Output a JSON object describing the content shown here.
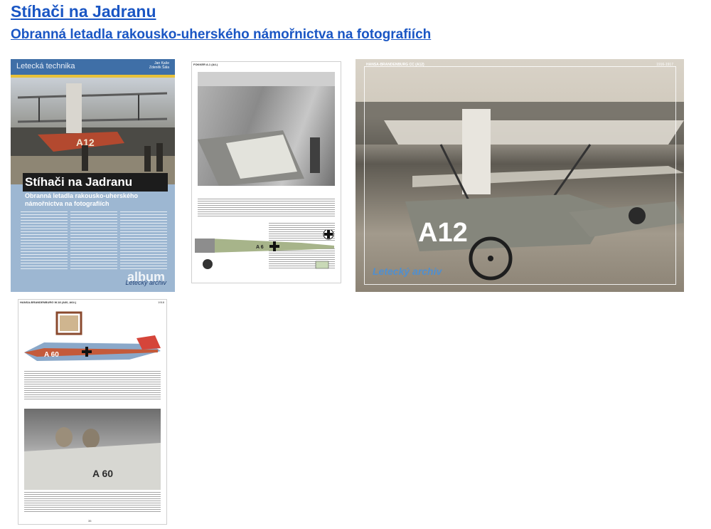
{
  "header": {
    "title": "Stíhači na Jadranu",
    "subtitle": "Obranná letadla rakousko-uherského námořnictva na fotografiích"
  },
  "gallery": {
    "cover": {
      "series": "Letecká technika",
      "authors": "Jan Kaše\nZdeněk Šála",
      "title": "Stíhači na Jadranu",
      "subtitle": "Obranná letadla rakousko-uherského námořnictva na fotografiích",
      "aircraft_code": "A12",
      "logo": "album",
      "logo_caption": "Letecký archiv"
    },
    "page_a": {
      "header": "FOKKER A.1 (A4.)",
      "aircraft_code": "A 6",
      "page_number": "4"
    },
    "page_b": {
      "header": "HANSA-BRANDENBURG CC (A12)",
      "header_right": "1916-1917",
      "aircraft_code": "A12",
      "logo": "Letecký archiv"
    },
    "page_c": {
      "header": "HANSA-BRANDENBURG W.18 (A60, A64.)",
      "header_right": "1918",
      "aircraft_code": "A 60",
      "page_number": "35"
    }
  }
}
